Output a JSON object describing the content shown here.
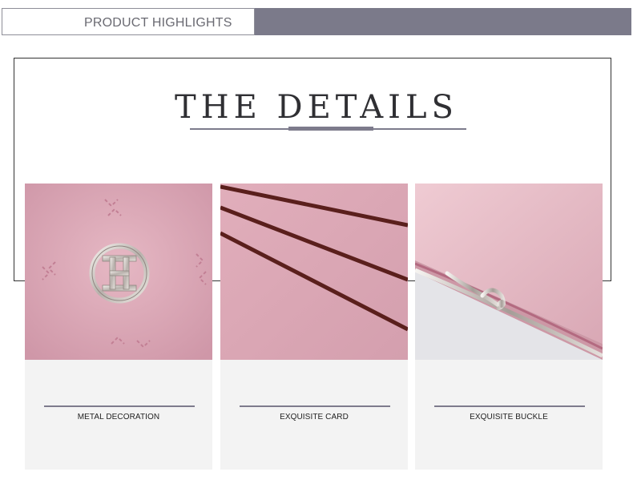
{
  "banner": {
    "label": "PRODUCT HIGHLIGHTS"
  },
  "section": {
    "title": "THE DETAILS"
  },
  "features": [
    {
      "label": "METAL DECORATION",
      "image": "metal-logo-emblem"
    },
    {
      "label": "EXQUISITE CARD",
      "image": "card-stripes"
    },
    {
      "label": "EXQUISITE BUCKLE",
      "image": "kiss-lock-buckle"
    }
  ],
  "colors": {
    "accent": "#7b7a8a",
    "leather_pink": "#dba9b7",
    "stripe_brown": "#5a1f1c",
    "card_background": "#f3f3f3"
  }
}
